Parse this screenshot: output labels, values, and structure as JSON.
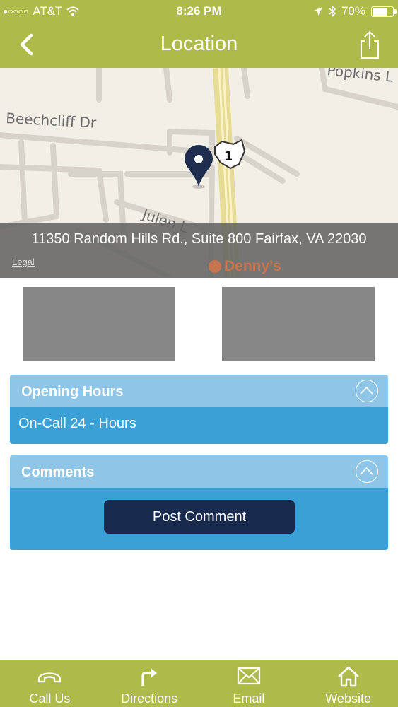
{
  "status_bar": {
    "carrier": "AT&T",
    "time": "8:26 PM",
    "battery": "70%",
    "battery_level": 0.7
  },
  "header": {
    "title": "Location"
  },
  "map": {
    "street_labels": [
      "Beechcliff Dr",
      "Popkins L",
      "Julen L"
    ],
    "route_number": "1",
    "address": "11350 Random Hills Rd., Suite 800  Fairfax, VA 22030",
    "legal_label": "Legal",
    "poi_label": "Denny's"
  },
  "opening_hours": {
    "title": "Opening Hours",
    "value": "On-Call 24 - Hours"
  },
  "comments": {
    "title": "Comments",
    "post_button": "Post Comment"
  },
  "tabbar": {
    "items": [
      {
        "label": "Call Us",
        "icon": "phone-icon"
      },
      {
        "label": "Directions",
        "icon": "directions-icon"
      },
      {
        "label": "Email",
        "icon": "email-icon"
      },
      {
        "label": "Website",
        "icon": "home-icon"
      }
    ]
  },
  "colors": {
    "brand_green": "#aebb4a",
    "panel_header": "#8fc5e6",
    "panel_body": "#3aa0d6",
    "button_navy": "#182a4e",
    "pin_navy": "#1f2d4f"
  }
}
